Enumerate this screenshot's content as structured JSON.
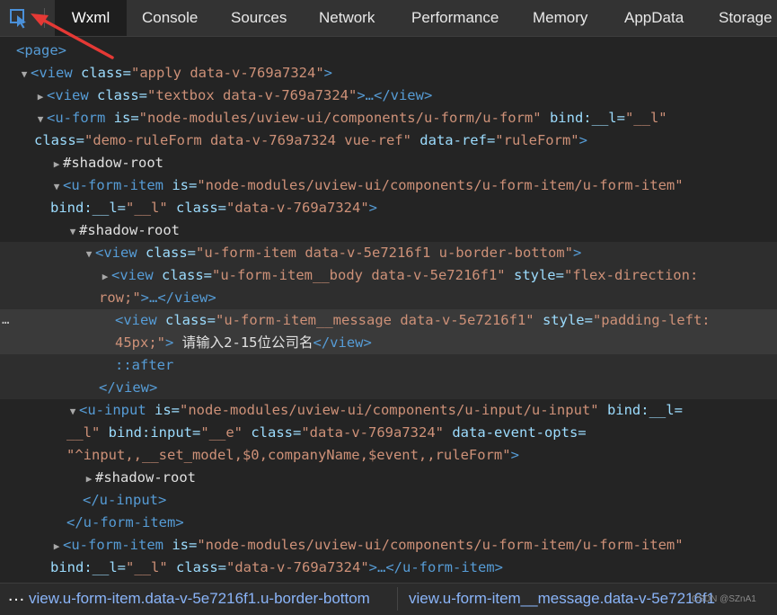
{
  "tabs": [
    {
      "label": "Wxml",
      "active": true
    },
    {
      "label": "Console"
    },
    {
      "label": "Sources"
    },
    {
      "label": "Network"
    },
    {
      "label": "Performance"
    },
    {
      "label": "Memory"
    },
    {
      "label": "AppData"
    },
    {
      "label": "Storage"
    }
  ],
  "icons": {
    "inspect": "element-picker-icon",
    "annotation": "red-arrow-annotation"
  },
  "colors": {
    "tag": "#569cd6",
    "attr_name": "#9cdcfe",
    "attr_value": "#ce9178",
    "arrow": "#e53935"
  },
  "tree": {
    "page_open": "<page>",
    "apply_open": {
      "tag": "<view",
      "a1": "class=",
      "v1": "\"apply data-v-769a7324\"",
      "end": ">"
    },
    "textbox": {
      "tag": "<view",
      "a1": "class=",
      "v1": "\"textbox data-v-769a7324\"",
      "mid": ">…",
      "end": "</view>"
    },
    "uform": {
      "tag": "<u-form",
      "a1": "is=",
      "v1": "\"node-modules/uview-ui/components/u-form/u-form\"",
      "a2": "bind:__l=",
      "v2": "\"__l\"",
      "a3": "class=",
      "v3": "\"demo-ruleForm data-v-769a7324 vue-ref\"",
      "a4": "data-ref=",
      "v4": "\"ruleForm\"",
      "end": ">"
    },
    "shadow_root": "#shadow-root",
    "uformitem": {
      "tag": "<u-form-item",
      "a1": "is=",
      "v1": "\"node-modules/uview-ui/components/u-form-item/u-form-item\"",
      "a2": "bind:__l=",
      "v2": "\"__l\"",
      "a3": "class=",
      "v3": "\"data-v-769a7324\"",
      "end": ">"
    },
    "view_border": {
      "tag": "<view",
      "a1": "class=",
      "v1": "\"u-form-item data-v-5e7216f1 u-border-bottom\"",
      "end": ">"
    },
    "view_body": {
      "tag": "<view",
      "a1": "class=",
      "v1": "\"u-form-item__body data-v-5e7216f1\"",
      "a2": "style=",
      "v2a": "\"flex-direction:",
      "v2b": "row;\"",
      "mid": ">…",
      "end": "</view>"
    },
    "view_message": {
      "tag": "<view",
      "a1": "class=",
      "v1": "\"u-form-item__message data-v-5e7216f1\"",
      "a2": "style=",
      "v2a": "\"padding-left:",
      "v2b": "45px;\"",
      "mid": ">",
      "text": " 请输入2-15位公司名",
      "end": "</view>"
    },
    "after": "::after",
    "view_close": "</view>",
    "uinput": {
      "tag": "<u-input",
      "a1": "is=",
      "v1": "\"node-modules/uview-ui/components/u-input/u-input\"",
      "a2": "bind:__l=",
      "v2a": "\"",
      "v2b": "__l\"",
      "a3": "bind:input=",
      "v3": "\"__e\"",
      "a4": "class=",
      "v4": "\"data-v-769a7324\"",
      "a5": "data-event-opts=",
      "v5": "\"^input,,__set_model,$0,companyName,$event,,ruleForm\"",
      "end": ">"
    },
    "uinput_close": "</u-input>",
    "uformitem_close": "</u-form-item>",
    "uformitem2": {
      "tag": "<u-form-item",
      "a1": "is=",
      "v1": "\"node-modules/uview-ui/components/u-form-item/u-form-item\"",
      "a2": "bind:__l=",
      "v2": "\"__l\"",
      "a3": "class=",
      "v3": "\"data-v-769a7324\"",
      "mid": ">…",
      "end": "</u-form-item>"
    },
    "row_more": "…"
  },
  "breadcrumb": {
    "more": "…",
    "item1": "view.u-form-item.data-v-5e7216f1.u-border-bottom",
    "item2": "view.u-form-item__message.data-v-5e7216f1",
    "watermark": "CSDN @SZnA1"
  }
}
